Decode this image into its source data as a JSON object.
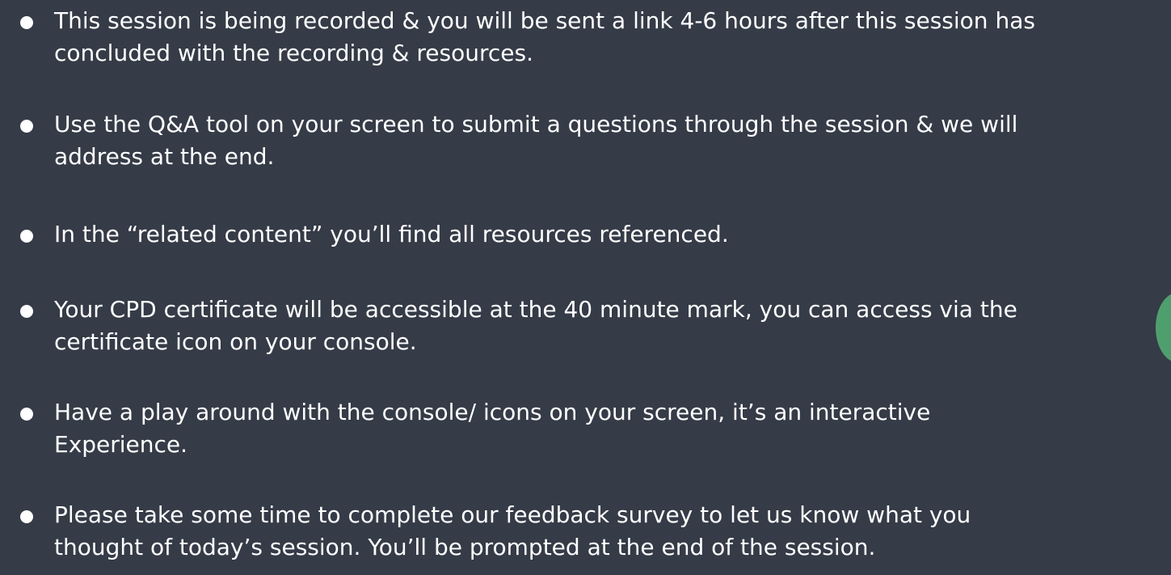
{
  "slide": {
    "bullets": [
      {
        "line1": "This session is being recorded & you will be sent a link 4-6 hours after this session has",
        "line2": "concluded with the recording & resources."
      },
      {
        "line1": "Use the Q&A tool on your screen to submit a questions through the session & we will",
        "line2": "address at the end."
      },
      {
        "line1": "In the “related content” you’ll find all resources referenced.",
        "line2": ""
      },
      {
        "line1": "Your CPD certificate will be accessible at the 40 minute mark, you can access via the",
        "line2": "certificate icon on your console."
      },
      {
        "line1": "Have a play around with the console/ icons on your screen, it’s an interactive",
        "line2": "Experience."
      },
      {
        "line1": "Please take some time to complete our feedback survey to let us know what you",
        "line2": "thought of today’s session. You’ll be prompted at the end of the session."
      }
    ]
  },
  "colors": {
    "background": "#353b47",
    "text": "#ffffff",
    "edge_widget": "#4f9f6e"
  }
}
